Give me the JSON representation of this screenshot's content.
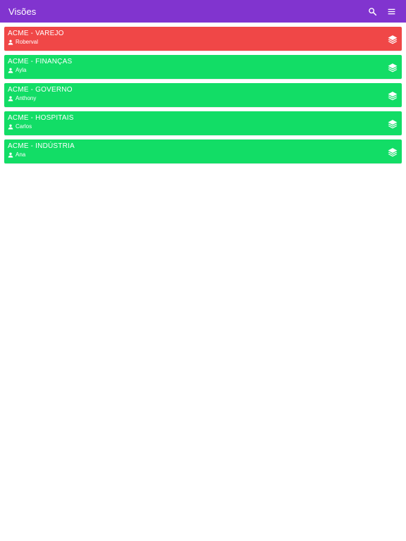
{
  "header": {
    "title": "Visões",
    "bg_color": "#8134cf",
    "actions": [
      {
        "name": "search-icon"
      },
      {
        "name": "menu-icon"
      }
    ]
  },
  "items": [
    {
      "title": "ACME - VAREJO",
      "person": "Roberval",
      "color": "#f04747",
      "icon": "layers-icon"
    },
    {
      "title": "ACME - FINANÇAS",
      "person": "Ayla",
      "color": "#12dd66",
      "icon": "layers-icon"
    },
    {
      "title": "ACME - GOVERNO",
      "person": "Anthony",
      "color": "#12dd66",
      "icon": "layers-icon"
    },
    {
      "title": "ACME - HOSPITAIS",
      "person": "Carlos",
      "color": "#12dd66",
      "icon": "layers-icon"
    },
    {
      "title": "ACME - INDÚSTRIA",
      "person": "Ana",
      "color": "#12dd66",
      "icon": "layers-icon"
    }
  ]
}
